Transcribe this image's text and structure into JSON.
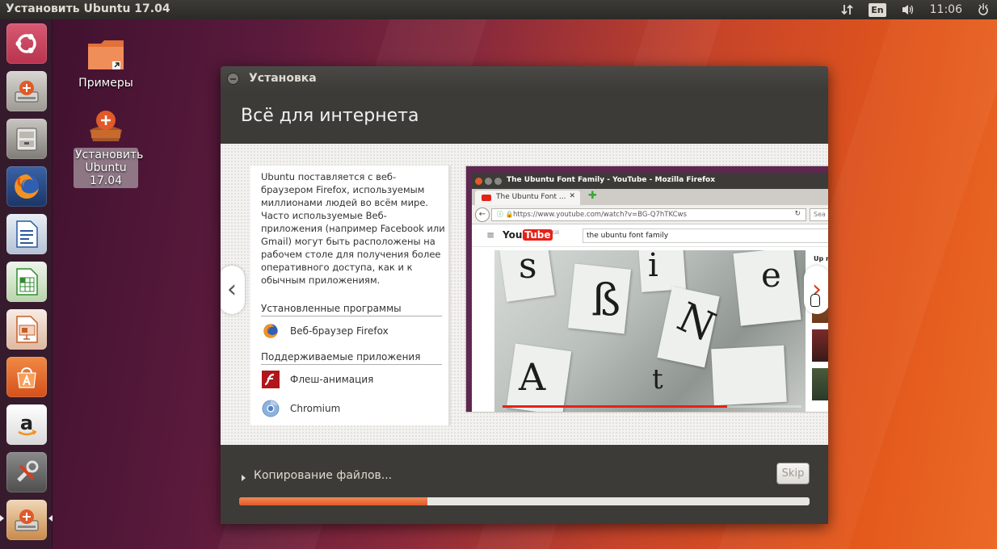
{
  "top_panel": {
    "title": "Установить Ubuntu 17.04",
    "keyboard_layout": "En",
    "clock": "11:06",
    "icons": [
      "network-transfer-icon",
      "volume-icon",
      "power-icon"
    ]
  },
  "launcher": {
    "items": [
      {
        "name": "ubuntu-dash",
        "icon": "ubuntu-logo-icon",
        "color": "#c7405b"
      },
      {
        "name": "install-ubuntu",
        "icon": "installer-icon",
        "color": "#a9a59f"
      },
      {
        "name": "files",
        "icon": "file-cabinet-icon",
        "color": "#8d8a85"
      },
      {
        "name": "firefox",
        "icon": "firefox-icon",
        "color": "#e66000"
      },
      {
        "name": "libreoffice-writer",
        "icon": "writer-icon",
        "color": "#2b6cb0"
      },
      {
        "name": "libreoffice-calc",
        "icon": "calc-icon",
        "color": "#2e8b2e"
      },
      {
        "name": "libreoffice-impress",
        "icon": "impress-icon",
        "color": "#c55e2a"
      },
      {
        "name": "ubuntu-software",
        "icon": "software-center-icon",
        "color": "#e06020"
      },
      {
        "name": "amazon",
        "icon": "amazon-icon",
        "color": "#f2f2f2"
      },
      {
        "name": "system-settings",
        "icon": "settings-icon",
        "color": "#6a6a6a"
      },
      {
        "name": "install-ubuntu-running",
        "icon": "installer-icon",
        "color": "#a9a59f"
      }
    ]
  },
  "desktop": {
    "icons": [
      {
        "label": "Примеры",
        "icon": "folder-icon"
      },
      {
        "label": "Установить Ubuntu 17.04",
        "icon": "installer-icon",
        "selected": true
      }
    ]
  },
  "window": {
    "title": "Установка",
    "heading": "Всё для интернета",
    "slide": {
      "description": "Ubuntu поставляется с веб-браузером Firefox, используемым миллионами людей во всём мире. Часто используемые Веб-приложения (например Facebook или Gmail) могут быть расположены на рабочем столе для получения более оперативного доступа, как и к обычным приложениям.",
      "installed_heading": "Установленные программы",
      "installed_apps": [
        {
          "label": "Веб-браузер Firefox",
          "icon": "firefox-icon"
        }
      ],
      "supported_heading": "Поддерживаемые приложения",
      "supported_apps": [
        {
          "label": "Флеш-анимация",
          "icon": "flash-icon"
        },
        {
          "label": "Chromium",
          "icon": "chromium-icon"
        }
      ],
      "prev_arrow": "‹",
      "next_arrow": "›",
      "screenshot": {
        "window_title": "The Ubuntu Font Family - YouTube - Mozilla Firefox",
        "tab_label": "The Ubuntu Font ...",
        "url": "https://www.youtube.com/watch?v=BG-Q7hTKCws",
        "search_placeholder": "Sea",
        "yt_logo": "You",
        "yt_logo_tube": "Tube",
        "yt_logo_sup": "GB",
        "yt_search": "the ubuntu font family",
        "side_label": "Up n",
        "video_progress": 0.75
      }
    },
    "status": "Копирование файлов...",
    "skip_label": "Skip",
    "progress": 0.33
  }
}
